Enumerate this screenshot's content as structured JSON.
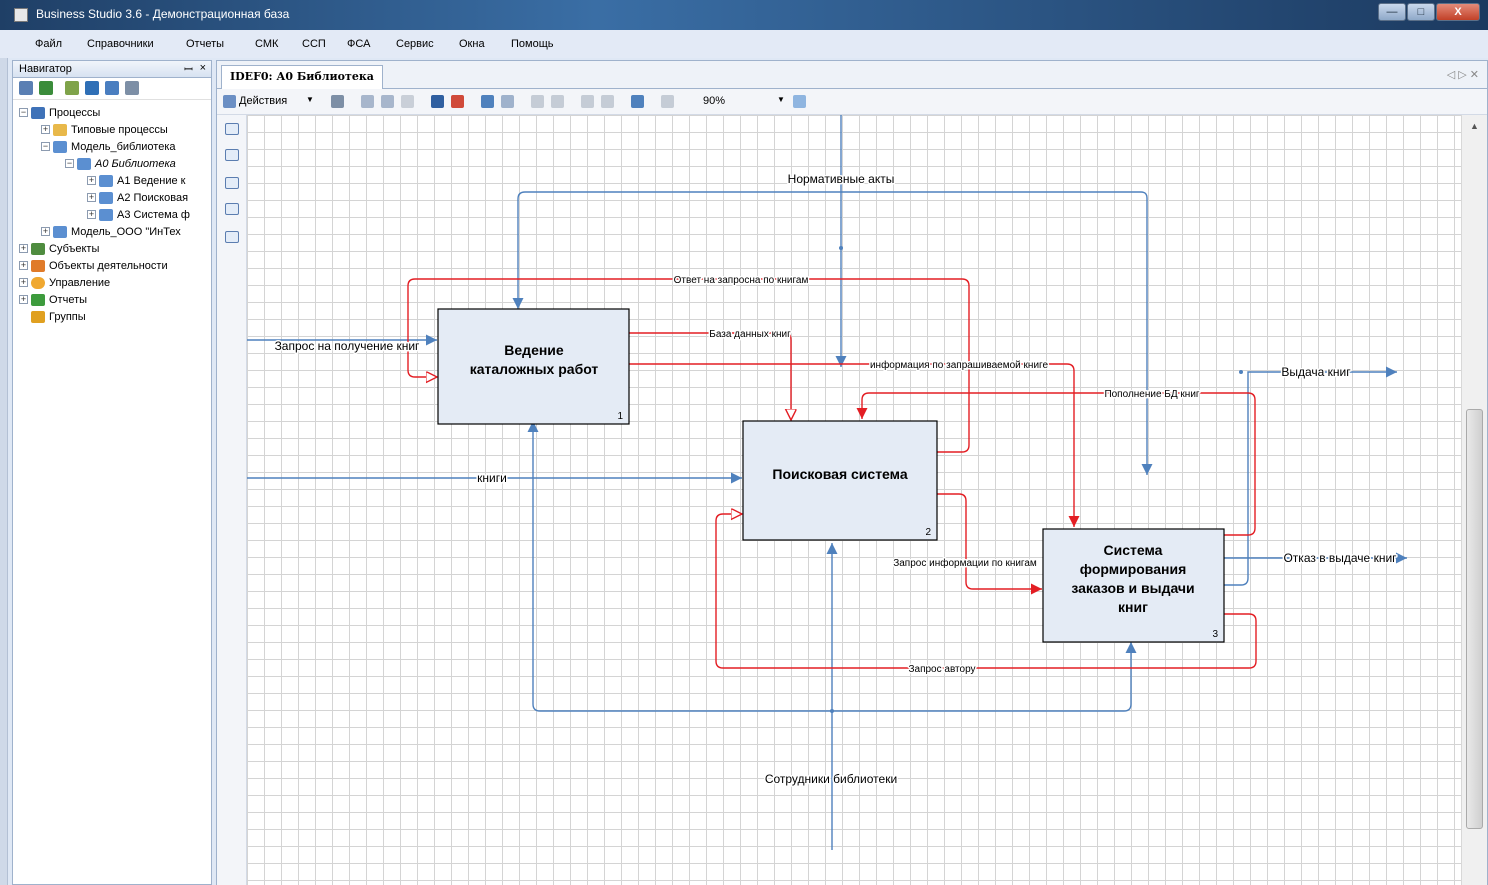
{
  "window": {
    "title": "Business Studio 3.6 - Демонстрационная база",
    "minimize": "—",
    "maximize": "□",
    "close": "X"
  },
  "menu": [
    "Файл",
    "Справочники",
    "Отчеты",
    "СМК",
    "ССП",
    "ФСА",
    "Сервис",
    "Окна",
    "Помощь"
  ],
  "navigator": {
    "title": "Навигатор",
    "pin": "ꟷ",
    "close": "×",
    "tree": [
      "Процессы",
      "Типовые процессы",
      "Модель_библиотека",
      "А0 Библиотека",
      "А1 Ведение к",
      "А2 Поисковая",
      "А3 Система ф",
      "Модель_ООО \"ИнТех",
      "Субъекты",
      "Объекты деятельности",
      "Управление",
      "Отчеты",
      "Группы"
    ]
  },
  "document": {
    "tab": "IDEF0: А0 Библиотека",
    "tab_nav": "◁ ▷ ✕",
    "toolbar": {
      "actions": "Действия",
      "zoom": "90%"
    }
  },
  "diagram": {
    "boxes": [
      {
        "id": "box-1",
        "label_lines": [
          "Ведение",
          "каталожных работ"
        ],
        "number": "1"
      },
      {
        "id": "box-2",
        "label_lines": [
          "Поисковая система"
        ],
        "number": "2"
      },
      {
        "id": "box-3",
        "label_lines": [
          "Система",
          "формирования",
          "заказов и выдачи",
          "книг"
        ],
        "number": "3"
      }
    ],
    "arrow_labels": {
      "normative": "Нормативные акты",
      "reply": "Ответ на запросна по книгам",
      "request": "Запрос на получение книг",
      "db": "База данных книг",
      "info": "информация по запрашиваемой книге",
      "replenish": "Пополнение БД книг",
      "issue": "Выдача книг",
      "books": "книги",
      "info_request": "Запрос информации по книгам",
      "refusal": "Отказ в выдаче книг",
      "author_request": "Запрос автору",
      "staff": "Сотрудники библиотеки"
    },
    "colors": {
      "box_fill": "#e4ebf5",
      "red_arrow": "#e31e24",
      "blue_arrow": "#4f81bd"
    }
  }
}
